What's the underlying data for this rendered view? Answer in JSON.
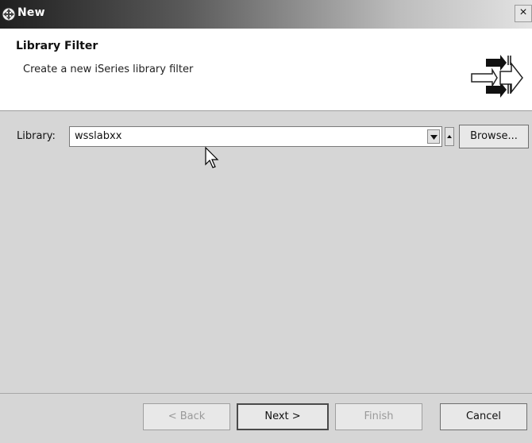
{
  "window": {
    "title": "New",
    "close_label": "×"
  },
  "header": {
    "title": "Library Filter",
    "description": "Create a new iSeries library filter",
    "icon": "wizard-arrows-icon"
  },
  "form": {
    "library_label": "Library:",
    "library_value": "wsslabxx",
    "browse_label": "Browse..."
  },
  "buttons": {
    "back": "< Back",
    "next": "Next >",
    "finish": "Finish",
    "cancel": "Cancel"
  },
  "icons": {
    "title": "eclipse-new-icon",
    "dropdown": "chevron-down-icon",
    "spinner": "spinner-icon",
    "cursor": "mouse-pointer-icon"
  },
  "colors": {
    "dialog_bg": "#d6d6d6",
    "header_bg": "#ffffff",
    "titlebar_dark": "#1f1f1f"
  }
}
